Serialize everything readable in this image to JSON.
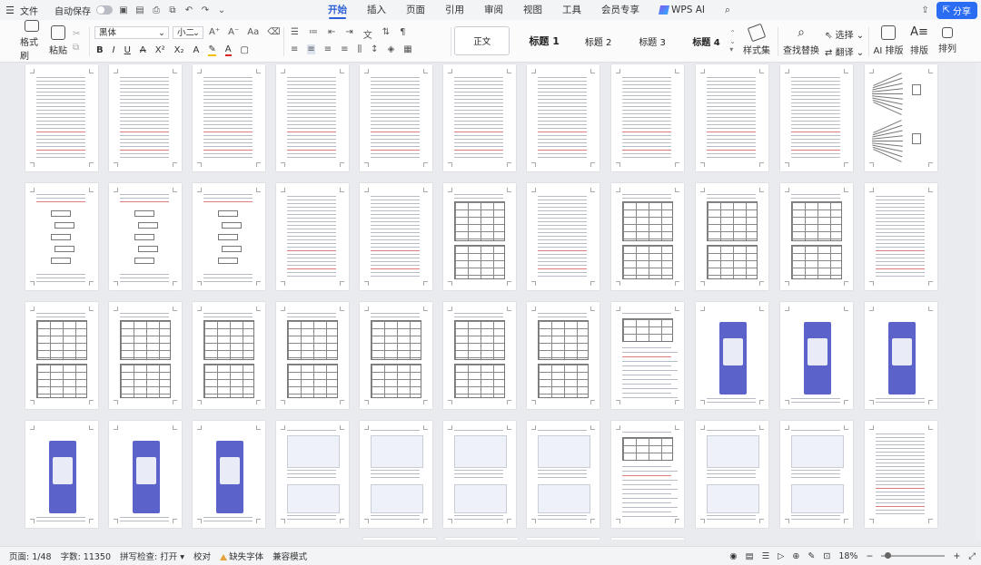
{
  "titlebar": {
    "menu_label": "文件",
    "autosave_label": "自动保存",
    "tabs": [
      {
        "label": "开始",
        "active": true
      },
      {
        "label": "插入"
      },
      {
        "label": "页面"
      },
      {
        "label": "引用"
      },
      {
        "label": "审阅"
      },
      {
        "label": "视图"
      },
      {
        "label": "工具"
      },
      {
        "label": "会员专享"
      }
    ],
    "wps_ai_label": "WPS AI",
    "share_label": "分享"
  },
  "ribbon": {
    "format_painter": "格式刷",
    "paste": "粘贴",
    "font_name": "黑体",
    "font_size": "小二",
    "styles": {
      "normal": "正文",
      "h1": "标题 1",
      "h2": "标题 2",
      "h3": "标题 3",
      "h4": "标题 4"
    },
    "style_set": "样式集",
    "find_replace": "查找替换",
    "select": "选择",
    "translate": "翻译",
    "ai_layout": "AI 排版",
    "layout": "排版",
    "arrange": "排列"
  },
  "statusbar": {
    "page": "页面: 1/48",
    "words": "字数: 11350",
    "spellcheck": "拼写检查: 打开",
    "proofread": "校对",
    "missing_font": "缺失字体",
    "compat_mode": "兼容模式",
    "zoom": "18%"
  },
  "colors": {
    "accent": "#2a5fd8",
    "share_button": "#2a6cf2",
    "phone_purple": "#5b62c9",
    "warning": "#e6a23c"
  }
}
